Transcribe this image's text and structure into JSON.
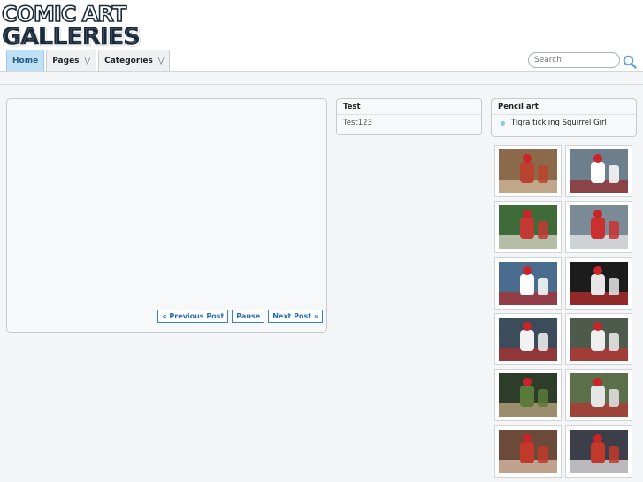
{
  "logo": {
    "line1": "COMIC ART",
    "line2": "GALLERIES"
  },
  "nav": {
    "items": [
      {
        "label": "Home",
        "active": true,
        "dropdown": false
      },
      {
        "label": "Pages",
        "active": false,
        "dropdown": true
      },
      {
        "label": "Categories",
        "active": false,
        "dropdown": true
      }
    ]
  },
  "search": {
    "placeholder": "Search",
    "icon": "magnifier-icon"
  },
  "slider": {
    "prev_label": "« Previous Post",
    "pause_label": "Pause",
    "next_label": "Next Post »"
  },
  "widgets": {
    "test": {
      "title": "Test",
      "body": "Test123"
    },
    "pencil": {
      "title": "Pencil art",
      "items": [
        "Tigra tickling Squirrel Girl"
      ]
    }
  },
  "thumbnails": [
    {
      "name": "thumb-baseball-1"
    },
    {
      "name": "thumb-baseball-2"
    },
    {
      "name": "thumb-baseball-3"
    },
    {
      "name": "thumb-baseball-4"
    },
    {
      "name": "thumb-baseball-5"
    },
    {
      "name": "thumb-baseball-6"
    },
    {
      "name": "thumb-baseball-7"
    },
    {
      "name": "thumb-baseball-8"
    },
    {
      "name": "thumb-baseball-9"
    },
    {
      "name": "thumb-baseball-10"
    },
    {
      "name": "thumb-baseball-11"
    },
    {
      "name": "thumb-baseball-12"
    }
  ],
  "colors": {
    "accent": "#2a6db0",
    "nav_active": "#bfe0f5",
    "bullet": "#8cc4ea"
  }
}
